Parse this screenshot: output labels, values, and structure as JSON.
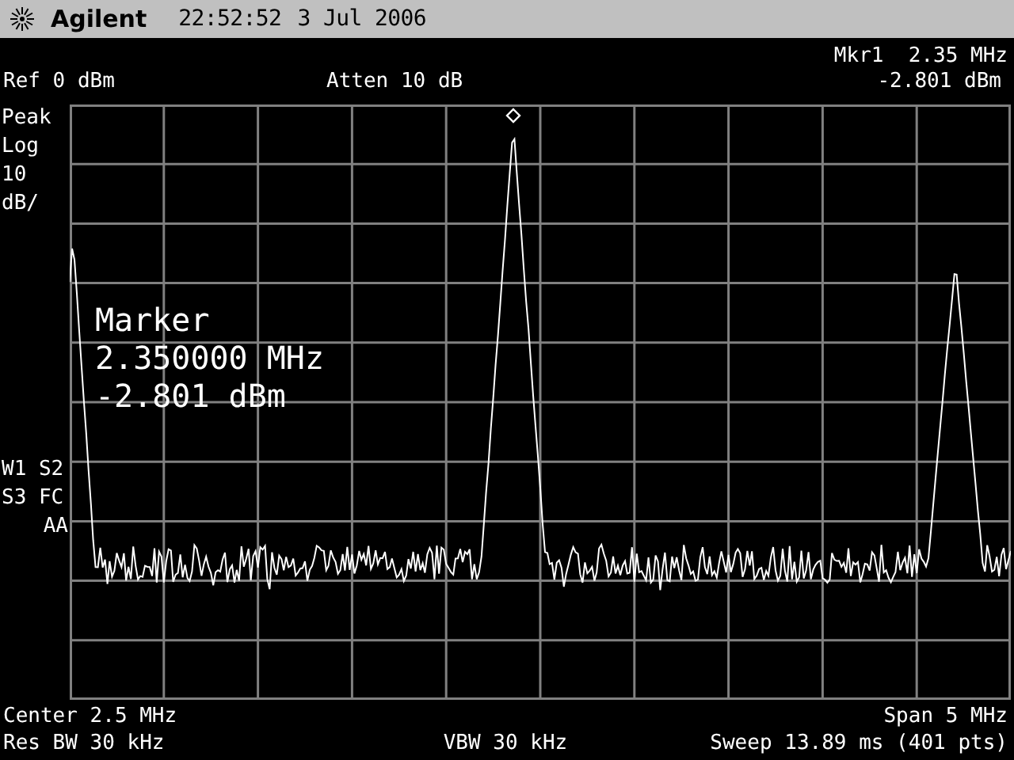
{
  "header": {
    "brand": "Agilent",
    "time": "22:52:52",
    "date": "3 Jul 2006"
  },
  "top_info": {
    "marker_readout": "Mkr1  2.35 MHz",
    "reference": "Ref 0 dBm",
    "attenuation": "Atten 10 dB",
    "marker_level": "-2.801 dBm"
  },
  "left_labels": [
    "Peak",
    "Log",
    "10",
    "dB/"
  ],
  "status_labels": [
    "W1 S2",
    "S3 FC",
    "AA"
  ],
  "marker_box": [
    "Marker",
    "2.350000 MHz",
    "-2.801 dBm"
  ],
  "footer": {
    "center": "Center 2.5 MHz",
    "span": "Span 5 MHz",
    "resolution_bandwidth": "Res BW 30 kHz",
    "video_bandwidth": "VBW 30 kHz",
    "sweep": "Sweep 13.89 ms (401 pts)"
  }
}
